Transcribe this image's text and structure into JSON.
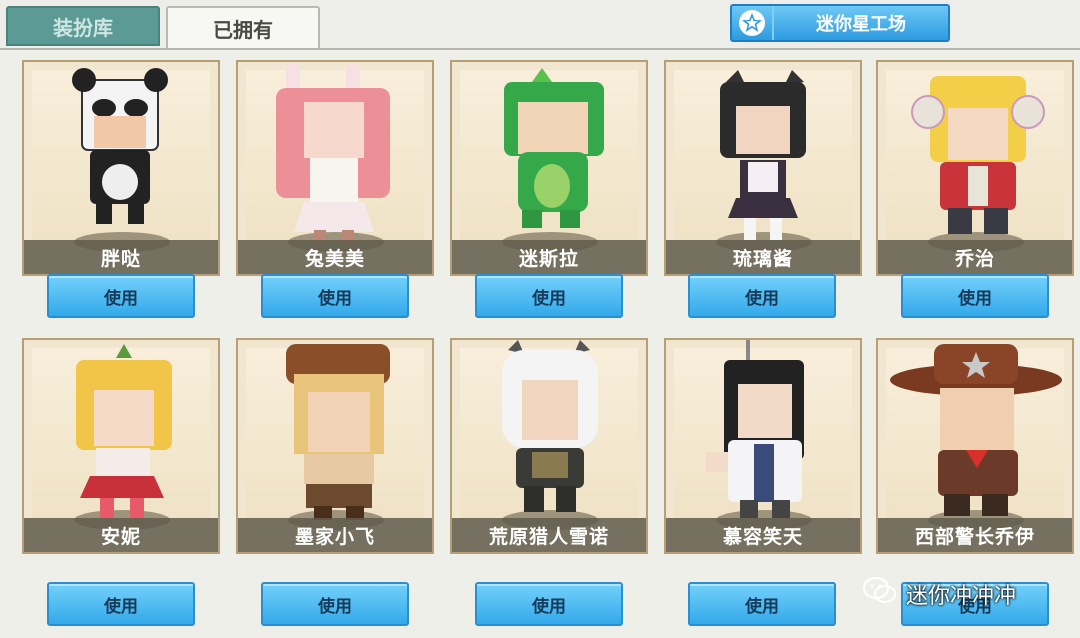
{
  "tabs": {
    "wardrobe": "装扮库",
    "owned": "已拥有"
  },
  "star_workshop": {
    "label": "迷你星工场",
    "icon": "star-icon"
  },
  "use_label": "使用",
  "colors": {
    "tab_active": "#5b9a95",
    "button_blue": "#33a9ea",
    "card_bg": "#f1e6cf"
  },
  "characters": [
    {
      "name": "胖哒",
      "icon": "panda-costume-character"
    },
    {
      "name": "兔美美",
      "icon": "bunny-girl-character"
    },
    {
      "name": "迷斯拉",
      "icon": "green-dino-character"
    },
    {
      "name": "琉璃酱",
      "icon": "cat-maid-character"
    },
    {
      "name": "乔治",
      "icon": "headphone-boy-character"
    },
    {
      "name": "安妮",
      "icon": "blonde-girl-character"
    },
    {
      "name": "墨家小飞",
      "icon": "aviator-girl-character"
    },
    {
      "name": "荒原猎人雪诺",
      "icon": "fur-hood-hunter-character"
    },
    {
      "name": "慕容笑天",
      "icon": "swordsman-character"
    },
    {
      "name": "西部警长乔伊",
      "icon": "sheriff-character"
    }
  ],
  "watermark": {
    "text": "迷你冲冲冲",
    "icon": "wechat-icon"
  }
}
